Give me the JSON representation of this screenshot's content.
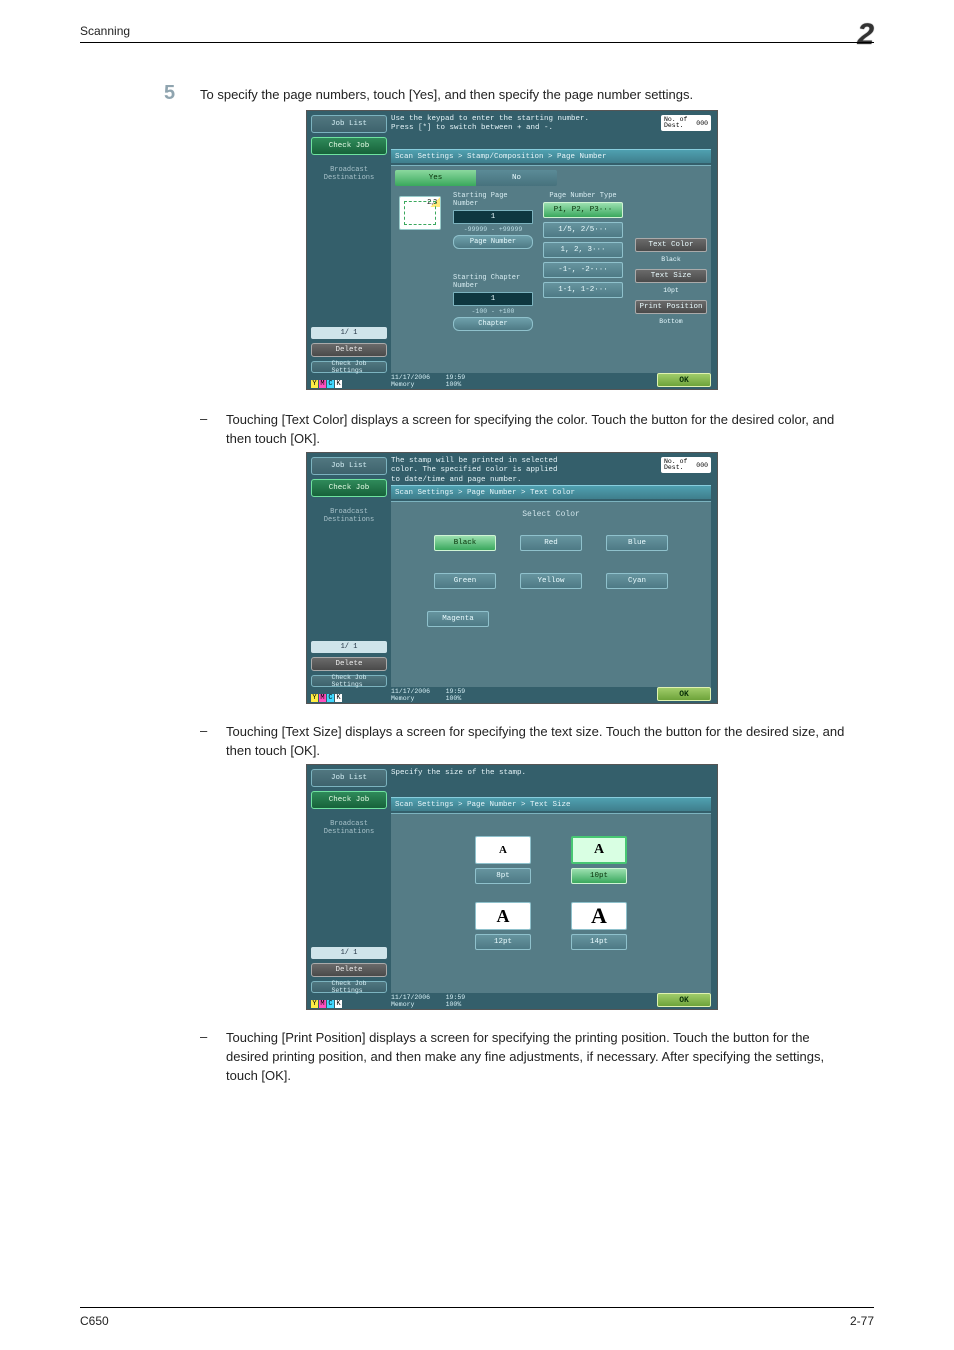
{
  "header": {
    "section": "Scanning",
    "chapter": "2"
  },
  "step": {
    "number": "5",
    "text": "To specify the page numbers, touch [Yes], and then specify the page number settings."
  },
  "bullets": {
    "a": "Touching [Text Color] displays a screen for specifying the color. Touch the button for the desired color, and then touch [OK].",
    "b": "Touching [Text Size] displays a screen for specifying the text size. Touch the button for the desired size, and then touch [OK].",
    "c": "Touching [Print Position] displays a screen for specifying the printing position. Touch the button for the desired printing position, and then make any fine adjustments, if necessary. After specifying the settings, touch [OK]."
  },
  "common": {
    "job_list": "Job List",
    "check_job": "Check Job",
    "broadcast": "Broadcast\nDestinations",
    "page_count": "1/   1",
    "delete": "Delete",
    "check_settings": "Check Job\nSettings",
    "date": "11/17/2006",
    "time": "19:59",
    "memory": "Memory",
    "mem_pct": "100%",
    "ok": "OK",
    "nodest_label": "No. of\nDest.",
    "nodest_val": "000",
    "toner": {
      "y": "Y",
      "m": "M",
      "c": "C",
      "k": "K"
    }
  },
  "panel1": {
    "tip": "Use the keypad to enter the starting number.\nPress [*] to switch between + and -.",
    "crumb": "Scan Settings > Stamp/Composition > Page Number",
    "yes": "Yes",
    "no": "No",
    "preview_text": "2,3",
    "starting_page_label": "Starting Page\nNumber",
    "starting_page_val": "1",
    "starting_page_range": "-99999   -   +99999",
    "page_number_btn": "Page Number",
    "type_label": "Page Number Type",
    "types": [
      "P1, P2, P3···",
      "1/5, 2/5···",
      "1, 2, 3···",
      "-1-, -2-···",
      "1-1, 1-2···"
    ],
    "starting_chapter_label": "Starting Chapter\nNumber",
    "starting_chapter_val": "1",
    "starting_chapter_range": "-100   -   +100",
    "chapter_btn": "Chapter",
    "side": {
      "text_color_btn": "Text Color",
      "text_color_val": "Black",
      "text_size_btn": "Text Size",
      "text_size_val": "10pt",
      "print_pos_btn": "Print Position",
      "print_pos_val": "Bottom"
    }
  },
  "panel2": {
    "tip": "The stamp will be printed in selected\ncolor. The specified color is applied\nto date/time and page number.",
    "crumb": "Scan Settings > Page Number > Text Color",
    "heading": "Select Color",
    "colors": [
      "Black",
      "Red",
      "Blue",
      "Green",
      "Yellow",
      "Cyan",
      "Magenta"
    ]
  },
  "panel3": {
    "tip": "Specify the size of the stamp.",
    "crumb": "Scan Settings > Page Number > Text Size",
    "sizes": [
      "8pt",
      "10pt",
      "12pt",
      "14pt"
    ]
  },
  "chart_data": {
    "type": "table",
    "title": "Page Number settings (panel 1)",
    "rows": [
      {
        "field": "Starting Page Number",
        "value": 1,
        "range": "-99999 .. +99999"
      },
      {
        "field": "Starting Chapter Number",
        "value": 1,
        "range": "-100 .. +100"
      },
      {
        "field": "Text Color",
        "value": "Black"
      },
      {
        "field": "Text Size",
        "value": "10pt"
      },
      {
        "field": "Print Position",
        "value": "Bottom"
      }
    ]
  },
  "footer": {
    "left": "C650",
    "right": "2-77"
  }
}
